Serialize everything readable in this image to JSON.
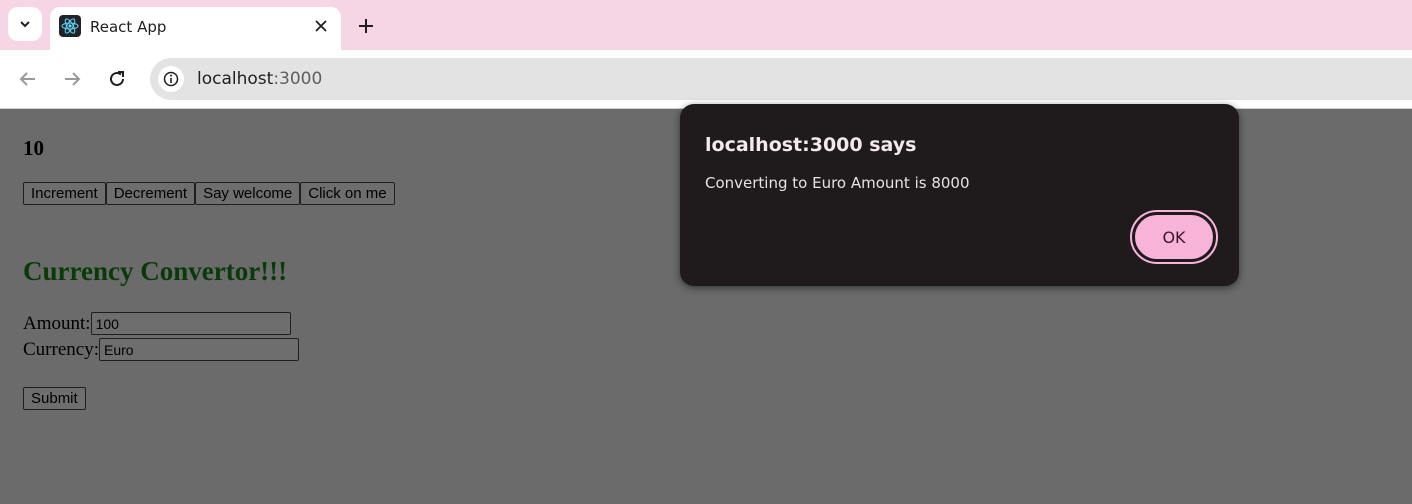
{
  "browser": {
    "tab": {
      "title": "React App"
    },
    "address": {
      "host": "localhost",
      "port": ":3000"
    }
  },
  "page": {
    "counter": "10",
    "buttons": [
      "Increment",
      "Decrement",
      "Say welcome",
      "Click on me"
    ],
    "heading": "Currency Convertor!!!",
    "form": {
      "amount_label": "Amount:",
      "amount_value": "100",
      "currency_label": "Currency:",
      "currency_value": "Euro",
      "submit_label": "Submit"
    }
  },
  "dialog": {
    "title": "localhost:3000 says",
    "message": "Converting to Euro Amount is 8000",
    "ok_label": "OK"
  },
  "colors": {
    "tabbar": "#f6d5e5",
    "scrim_page": "#6b6b6b",
    "heading": "#0a3a0a",
    "dialog_bg": "#1f1a1c",
    "ok_button": "#f8b4d8"
  }
}
